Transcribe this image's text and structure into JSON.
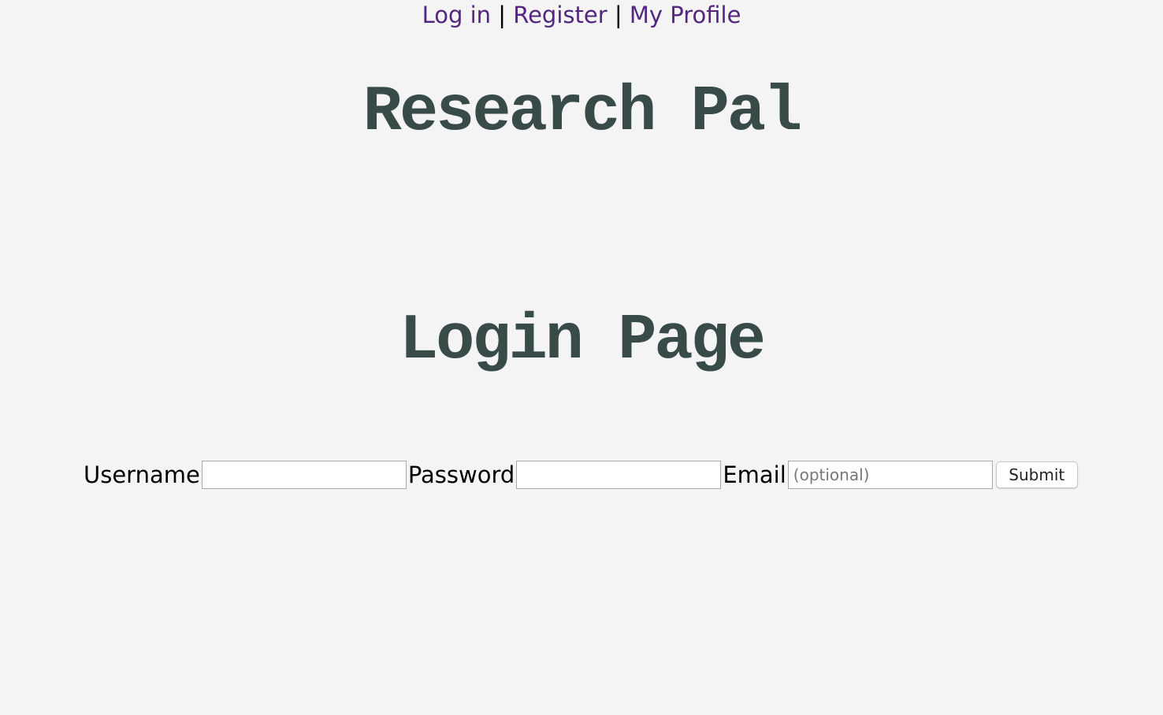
{
  "nav": {
    "login": "Log in",
    "separator": "|",
    "register": "Register",
    "profile": "My Profile",
    "link_color": "#53267f"
  },
  "site_title": "Research Pal",
  "page_heading": "Login Page",
  "heading_color": "#394b49",
  "form": {
    "username_label": "Username",
    "username_value": "",
    "password_label": "Password",
    "password_value": "",
    "email_label": "Email",
    "email_value": "",
    "email_placeholder": "(optional)",
    "submit_label": "Submit"
  },
  "background_color": "#f4f4f4"
}
